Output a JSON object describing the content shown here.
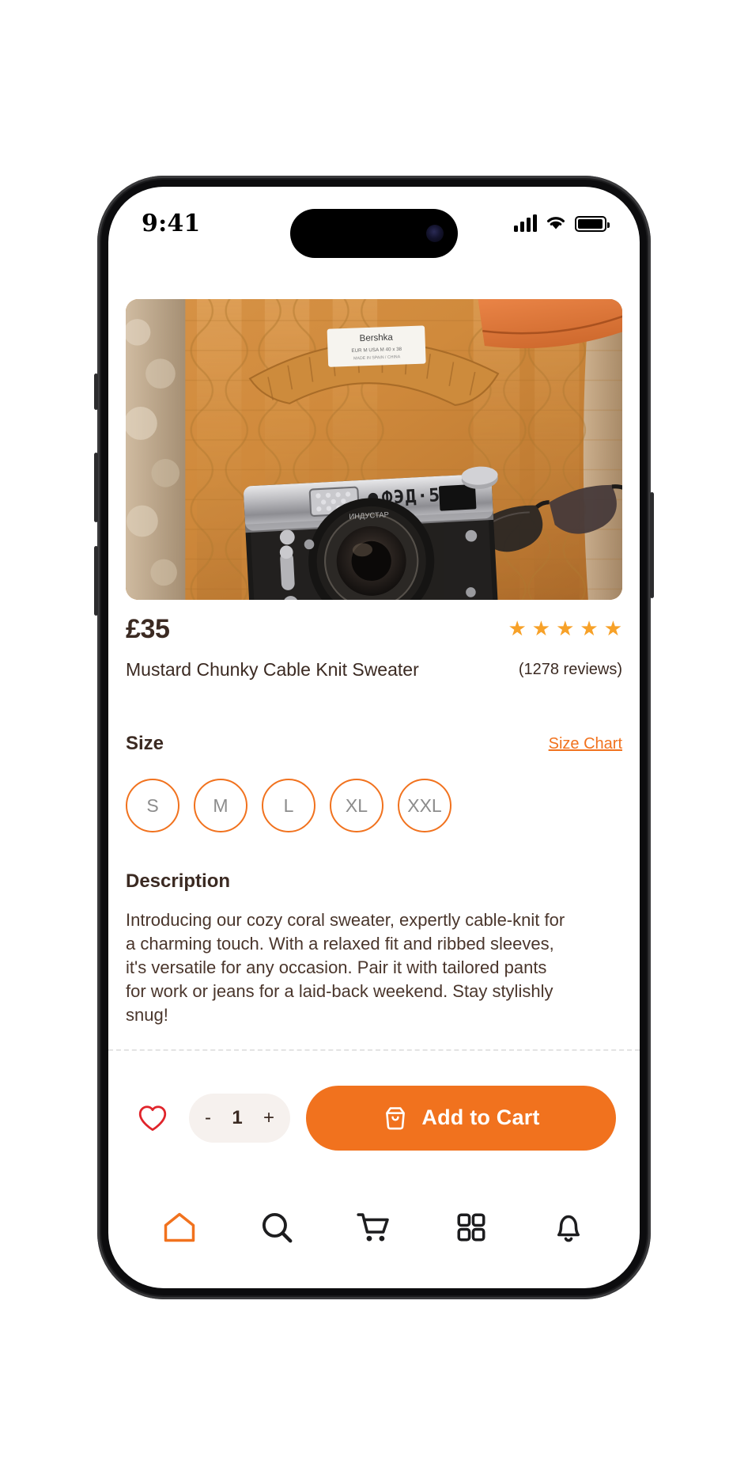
{
  "status_bar": {
    "time": "9:41",
    "icons": [
      "cellular-signal-icon",
      "wifi-icon",
      "battery-icon"
    ]
  },
  "product": {
    "image_alt": "mustard-chunky-cable-knit-sweater-with-vintage-camera",
    "price": "£35",
    "title": "Mustard Chunky Cable Knit Sweater",
    "rating_stars": 5,
    "review_count_label": "(1278 reviews)"
  },
  "size_section": {
    "label": "Size",
    "chart_link": "Size Chart",
    "options": [
      "S",
      "M",
      "L",
      "XL",
      "XXL"
    ]
  },
  "description_section": {
    "title": "Description",
    "body": "Introducing our cozy coral sweater, expertly cable-knit for a charming touch. With a relaxed fit and ribbed sleeves, it's versatile for any occasion. Pair it with tailored pants for work or jeans for a laid-back weekend. Stay stylishly snug!"
  },
  "action_bar": {
    "wishlist_icon": "heart-icon",
    "quantity": {
      "decrement": "-",
      "value": "1",
      "increment": "+"
    },
    "add_to_cart_label": "Add to Cart",
    "add_to_cart_icon": "shopping-bag-icon"
  },
  "bottom_nav": {
    "items": [
      {
        "name": "home",
        "icon": "home-icon",
        "active": true
      },
      {
        "name": "search",
        "icon": "search-icon",
        "active": false
      },
      {
        "name": "cart",
        "icon": "shopping-cart-icon",
        "active": false
      },
      {
        "name": "categories",
        "icon": "grid-icon",
        "active": false
      },
      {
        "name": "notifications",
        "icon": "bell-icon",
        "active": false
      }
    ]
  },
  "colors": {
    "accent": "#F1721E",
    "star": "#F7A128",
    "text_dark": "#3b2a22",
    "heart": "#E0242B",
    "muted": "#8c8c8c"
  }
}
